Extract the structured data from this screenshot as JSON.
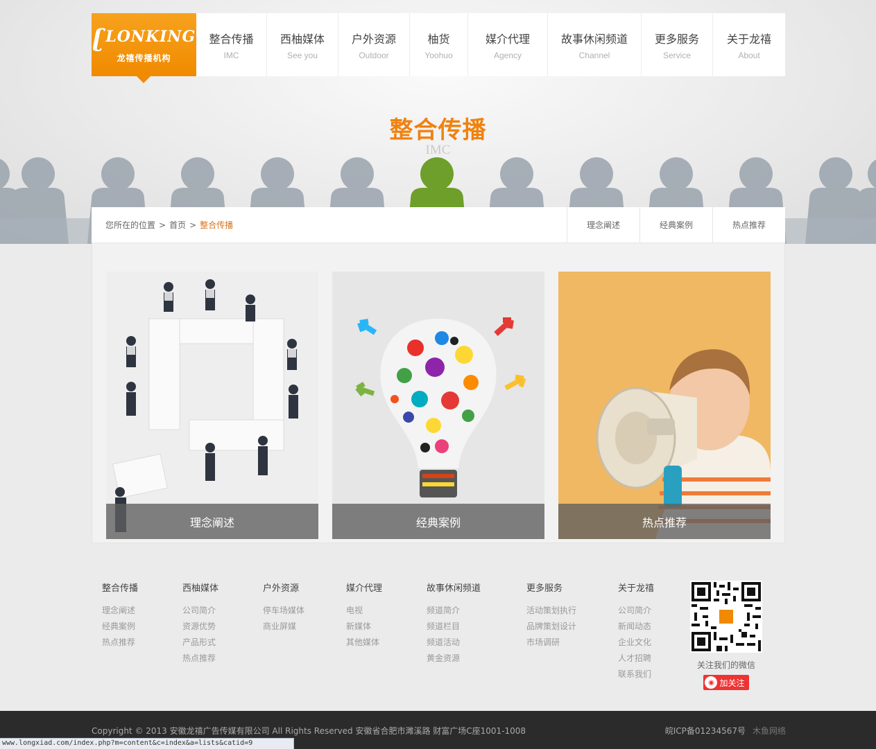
{
  "logo": {
    "mark": "LONKING",
    "name": "龙禧传播机构"
  },
  "nav": [
    {
      "cn": "整合传播",
      "en": "IMC"
    },
    {
      "cn": "西柚媒体",
      "en": "See you"
    },
    {
      "cn": "户外资源",
      "en": "Outdoor"
    },
    {
      "cn": "柚货",
      "en": "Yoohuo"
    },
    {
      "cn": "媒介代理",
      "en": "Agency"
    },
    {
      "cn": "故事休闲频道",
      "en": "Channel"
    },
    {
      "cn": "更多服务",
      "en": "Service"
    },
    {
      "cn": "关于龙禧",
      "en": "About"
    }
  ],
  "hero": {
    "title": "整合传播",
    "subtitle": "IMC"
  },
  "breadcrumb": {
    "prefix": "您所在的位置",
    "sep": ">",
    "home": "首页",
    "current": "整合传播"
  },
  "sub_tabs": [
    "理念阐述",
    "经典案例",
    "热点推荐"
  ],
  "cards": [
    {
      "caption": "理念阐述"
    },
    {
      "caption": "经典案例"
    },
    {
      "caption": "热点推荐"
    }
  ],
  "footer": {
    "columns": [
      {
        "title": "整合传播",
        "links": [
          "理念阐述",
          "经典案例",
          "热点推荐"
        ]
      },
      {
        "title": "西柚媒体",
        "links": [
          "公司简介",
          "资源优势",
          "产品形式",
          "热点推荐"
        ]
      },
      {
        "title": "户外资源",
        "links": [
          "停车场媒体",
          "商业屏媒"
        ]
      },
      {
        "title": "媒介代理",
        "links": [
          "电视",
          "新媒体",
          "其他媒体"
        ]
      },
      {
        "title": "故事休闲频道",
        "links": [
          "频道简介",
          "频道栏目",
          "频道活动",
          "黄金资源"
        ]
      },
      {
        "title": "更多服务",
        "links": [
          "活动策划执行",
          "品牌策划设计",
          "市场调研"
        ]
      },
      {
        "title": "关于龙禧",
        "links": [
          "公司简介",
          "新闻动态",
          "企业文化",
          "人才招聘",
          "联系我们"
        ]
      }
    ],
    "qr_caption": "关注我们的微信",
    "weibo_label": "加关注"
  },
  "bottom": {
    "copyright": "Copyright © 2013 安徽龙禧广告传媒有限公司  All Rights Reserved  安徽省合肥市濉溪路  财富广场C座1001-1008",
    "icp": "皖ICP备01234567号",
    "maker": "木鱼网络"
  },
  "status_url": "www.longxiad.com/index.php?m=content&c=index&a=lists&catid=9",
  "colors": {
    "accent": "#f0820f",
    "logo_bg": "#f08a00",
    "dark_bar": "#2b2b2b"
  }
}
